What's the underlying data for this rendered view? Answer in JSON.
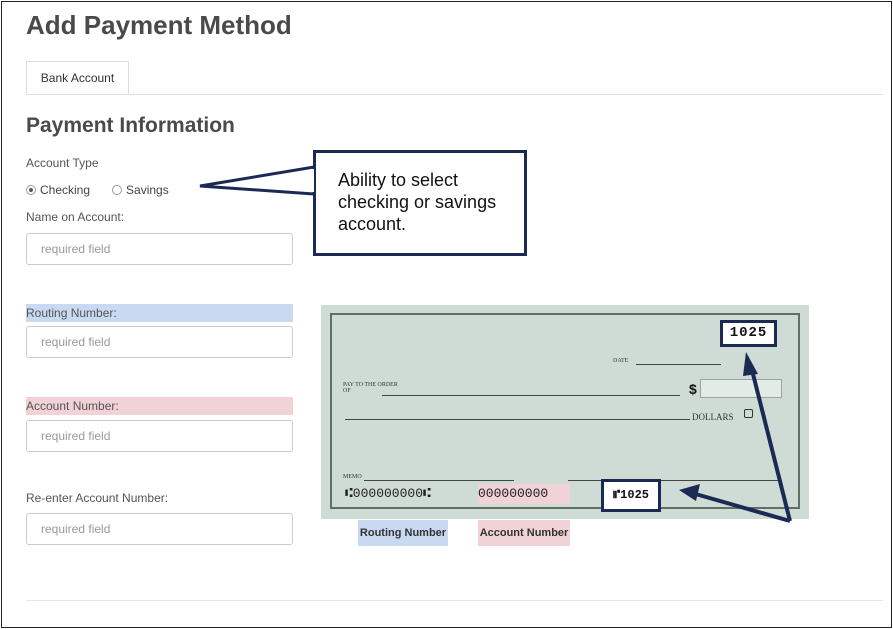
{
  "page": {
    "title": "Add Payment Method"
  },
  "tabs": [
    {
      "label": "Bank Account",
      "active": true
    }
  ],
  "section": {
    "title": "Payment Information"
  },
  "form": {
    "account_type_label": "Account Type",
    "account_type_options": [
      {
        "label": "Checking",
        "selected": true
      },
      {
        "label": "Savings",
        "selected": false
      }
    ],
    "name_label": "Name on Account:",
    "name_placeholder": "required field",
    "routing_label": "Routing Number:",
    "routing_placeholder": "required field",
    "account_label": "Account Number:",
    "account_placeholder": "required field",
    "reenter_label": "Re-enter Account Number:",
    "reenter_placeholder": "required field"
  },
  "callout": {
    "text": "Ability to select checking or savings account."
  },
  "check": {
    "number": "1025",
    "date_label": "DATE",
    "pay_to_label": "PAY TO THE ORDER OF",
    "dollar_sign": "$",
    "dollars_label": "DOLLARS",
    "memo_label": "MEMO",
    "routing_micr": "⑆000000000⑆",
    "account_micr": "000000000",
    "check_micr": "⑈1025",
    "routing_tag": "Routing Number",
    "account_tag": "Account Number"
  },
  "colors": {
    "routing_highlight": "#c9d9f1",
    "account_highlight": "#f1d2d6",
    "callout_border": "#1b2a55",
    "check_background": "#cfdcd5"
  }
}
